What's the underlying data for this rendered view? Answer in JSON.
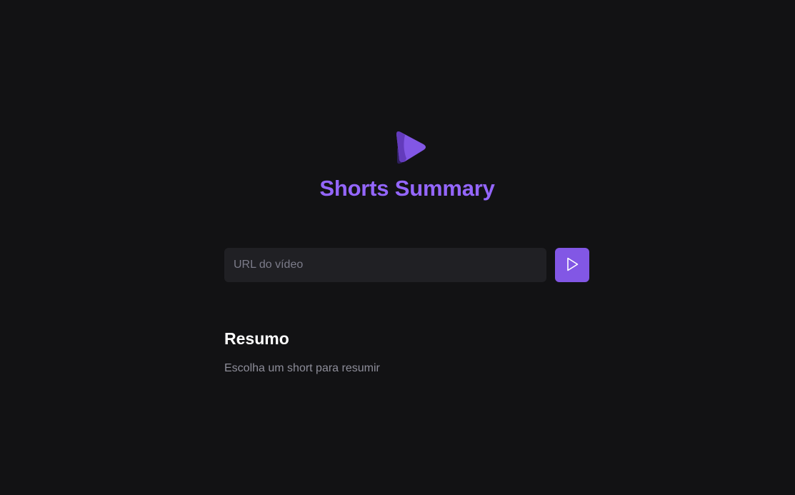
{
  "app": {
    "title": "Shorts Summary",
    "logo_icon": "play-logo-icon"
  },
  "form": {
    "url_placeholder": "URL do vídeo",
    "url_value": "",
    "submit_icon": "play-icon"
  },
  "summary": {
    "heading": "Resumo",
    "text": "Escolha um short para resumir"
  },
  "colors": {
    "background": "#121214",
    "accent": "#8257e5",
    "title": "#9466ff",
    "input_bg": "#202024",
    "muted_text": "#8d8d99"
  }
}
